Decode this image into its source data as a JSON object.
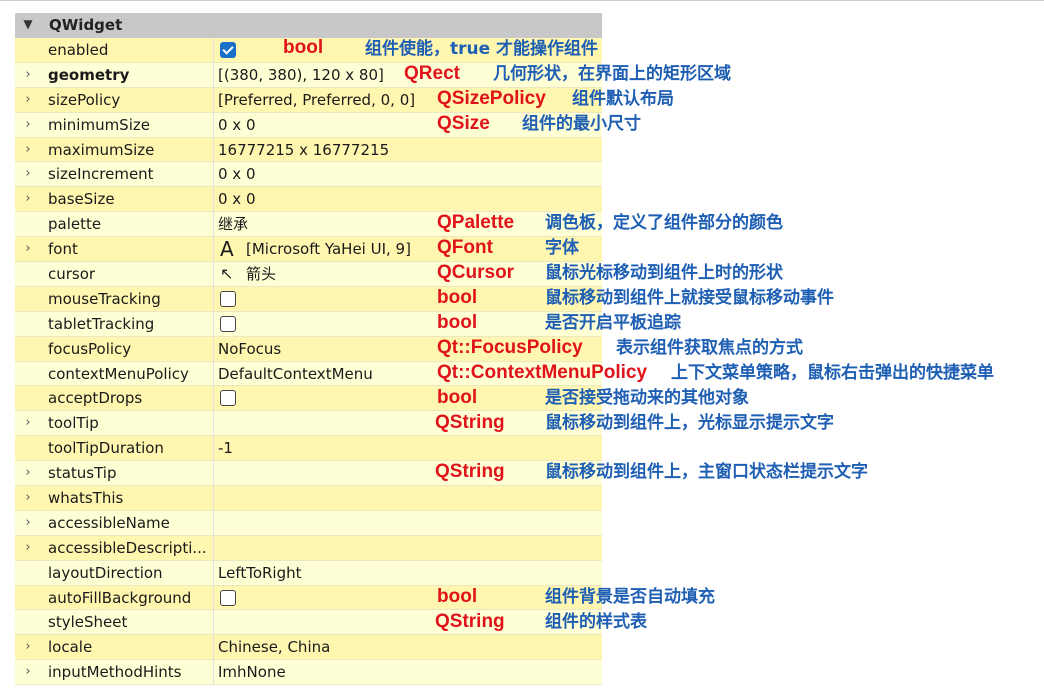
{
  "group": {
    "title": "QWidget",
    "expanded": true
  },
  "rows": [
    {
      "name": "enabled",
      "expandable": false,
      "value_kind": "checkbox",
      "checked": true,
      "value": "",
      "type": "bool",
      "desc": "组件使能，true 才能操作组件",
      "bg": 1
    },
    {
      "name": "geometry",
      "bold": true,
      "expandable": true,
      "value": "[(380, 380), 120 x 80]",
      "type": "QRect",
      "desc": "几何形状，在界面上的矩形区域",
      "bg": 2
    },
    {
      "name": "sizePolicy",
      "expandable": true,
      "value": "[Preferred, Preferred, 0, 0]",
      "type": "QSizePolicy",
      "desc": "组件默认布局",
      "bg": 1
    },
    {
      "name": "minimumSize",
      "expandable": true,
      "value": "0 x 0",
      "type": "QSize",
      "desc": "组件的最小尺寸",
      "bg": 2
    },
    {
      "name": "maximumSize",
      "expandable": true,
      "value": "16777215 x 16777215",
      "type": "",
      "desc": "",
      "bg": 1
    },
    {
      "name": "sizeIncrement",
      "expandable": true,
      "value": "0 x 0",
      "type": "",
      "desc": "",
      "bg": 2
    },
    {
      "name": "baseSize",
      "expandable": true,
      "value": "0 x 0",
      "type": "",
      "desc": "",
      "bg": 1
    },
    {
      "name": "palette",
      "expandable": false,
      "value": "继承",
      "type": "QPalette",
      "desc": "调色板，定义了组件部分的颜色",
      "bg": 2
    },
    {
      "name": "font",
      "expandable": true,
      "value_kind": "font",
      "value": "[Microsoft YaHei UI, 9]",
      "icon": "font-A-icon",
      "icon_glyph": "A",
      "type": "QFont",
      "desc": "字体",
      "bg": 1
    },
    {
      "name": "cursor",
      "expandable": false,
      "value_kind": "cursor",
      "value": "箭头",
      "icon": "arrow-cursor-icon",
      "icon_glyph": "↖",
      "type": "QCursor",
      "desc": "鼠标光标移动到组件上时的形状",
      "bg": 2
    },
    {
      "name": "mouseTracking",
      "expandable": false,
      "value_kind": "checkbox",
      "checked": false,
      "value": "",
      "type": "bool",
      "desc": "鼠标移动到组件上就接受鼠标移动事件",
      "bg": 1
    },
    {
      "name": "tabletTracking",
      "expandable": false,
      "value_kind": "checkbox",
      "checked": false,
      "value": "",
      "type": "bool",
      "desc": "是否开启平板追踪",
      "bg": 2
    },
    {
      "name": "focusPolicy",
      "expandable": false,
      "value": "NoFocus",
      "type": "Qt::FocusPolicy",
      "desc": "表示组件获取焦点的方式",
      "bg": 1
    },
    {
      "name": "contextMenuPolicy",
      "expandable": false,
      "value": "DefaultContextMenu",
      "type": "Qt::ContextMenuPolicy",
      "desc": "上下文菜单策略，鼠标右击弹出的快捷菜单",
      "bg": 2
    },
    {
      "name": "acceptDrops",
      "expandable": false,
      "value_kind": "checkbox",
      "checked": false,
      "value": "",
      "type": "bool",
      "desc": "是否接受拖动来的其他对象",
      "bg": 1
    },
    {
      "name": "toolTip",
      "expandable": true,
      "value": "",
      "type": "QString",
      "desc": "鼠标移动到组件上，光标显示提示文字",
      "bg": 2
    },
    {
      "name": "toolTipDuration",
      "expandable": false,
      "value": "-1",
      "type": "",
      "desc": "",
      "bg": 1
    },
    {
      "name": "statusTip",
      "expandable": true,
      "value": "",
      "type": "QString",
      "desc": "鼠标移动到组件上，主窗口状态栏提示文字",
      "bg": 2
    },
    {
      "name": "whatsThis",
      "expandable": true,
      "value": "",
      "type": "",
      "desc": "",
      "bg": 1
    },
    {
      "name": "accessibleName",
      "expandable": true,
      "value": "",
      "type": "",
      "desc": "",
      "bg": 2
    },
    {
      "name": "accessibleDescripti...",
      "expandable": true,
      "value": "",
      "type": "",
      "desc": "",
      "bg": 1
    },
    {
      "name": "layoutDirection",
      "expandable": false,
      "value": "LeftToRight",
      "type": "",
      "desc": "",
      "bg": 2
    },
    {
      "name": "autoFillBackground",
      "expandable": false,
      "value_kind": "checkbox",
      "checked": false,
      "value": "",
      "type": "bool",
      "desc": "组件背景是否自动填充",
      "bg": 1
    },
    {
      "name": "styleSheet",
      "expandable": false,
      "value": "",
      "type": "QString",
      "desc": "组件的样式表",
      "bg": 2
    },
    {
      "name": "locale",
      "expandable": true,
      "value": "Chinese, China",
      "type": "",
      "desc": "",
      "bg": 1
    },
    {
      "name": "inputMethodHints",
      "expandable": true,
      "value": "ImhNone",
      "type": "",
      "desc": "",
      "bg": 2
    }
  ],
  "colors": {
    "type_annotation": "#e0121a",
    "description_annotation": "#1e5fb4",
    "row_a": "#fff6b0",
    "row_b": "#ffffd6",
    "header": "#c8c8c8"
  }
}
